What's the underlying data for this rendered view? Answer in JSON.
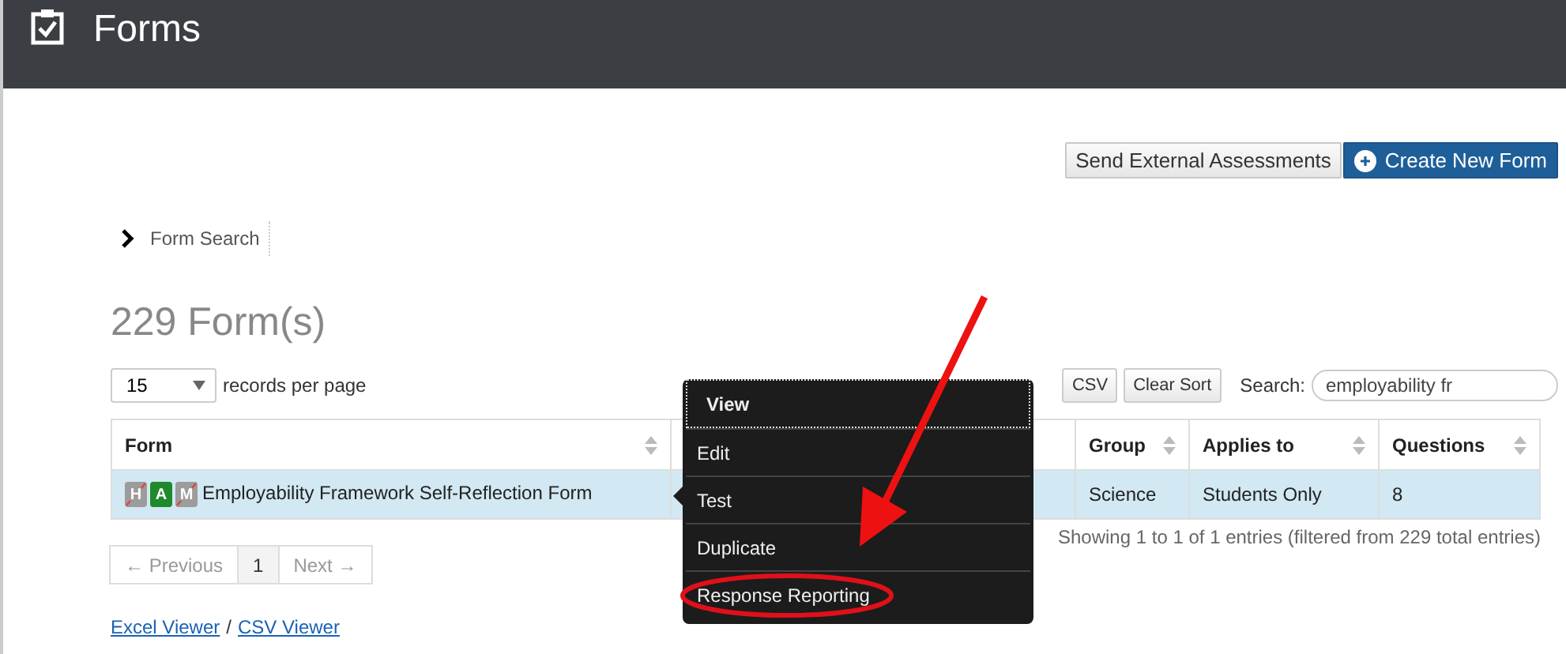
{
  "header": {
    "title": "Forms"
  },
  "actions": [
    {
      "label": "Send External Assessments",
      "kind": "plain"
    },
    {
      "label": "Create New Form",
      "kind": "primary"
    }
  ],
  "search_panel": {
    "label": "Form Search",
    "expanded": false
  },
  "summary": {
    "title": "229 Form(s)"
  },
  "page_size": {
    "value": "15",
    "label": "records per page"
  },
  "toolbar": {
    "buttons": [
      "CSV",
      "Clear Sort"
    ],
    "search_label": "Search:",
    "search_value": "employability fr"
  },
  "table": {
    "columns": [
      "Form",
      "Group",
      "Applies to",
      "Questions"
    ],
    "rows": [
      {
        "badges": [
          {
            "label": "H",
            "enabled": false
          },
          {
            "label": "A",
            "enabled": true
          },
          {
            "label": "M",
            "enabled": false
          }
        ],
        "cells": [
          "Employability Framework Self-Reflection Form",
          "Science",
          "Students Only",
          "8"
        ],
        "selected": true
      }
    ]
  },
  "info": "Showing 1 to 1 of 1 entries (filtered from 229 total entries)",
  "pagination": [
    {
      "label": "← Previous",
      "kind": "nav",
      "disabled": true
    },
    {
      "label": "1",
      "kind": "page",
      "selected": true
    },
    {
      "label": "Next →",
      "kind": "nav",
      "disabled": true
    }
  ],
  "export_links": [
    "Excel Viewer",
    "CSV Viewer"
  ],
  "export_separator": "/",
  "context_menu": [
    {
      "label": "View",
      "selected": true
    },
    {
      "label": "Edit",
      "selected": false
    },
    {
      "label": "Test",
      "selected": false
    },
    {
      "label": "Duplicate",
      "selected": false
    },
    {
      "label": "Response Reporting",
      "selected": false,
      "circled": true
    }
  ]
}
